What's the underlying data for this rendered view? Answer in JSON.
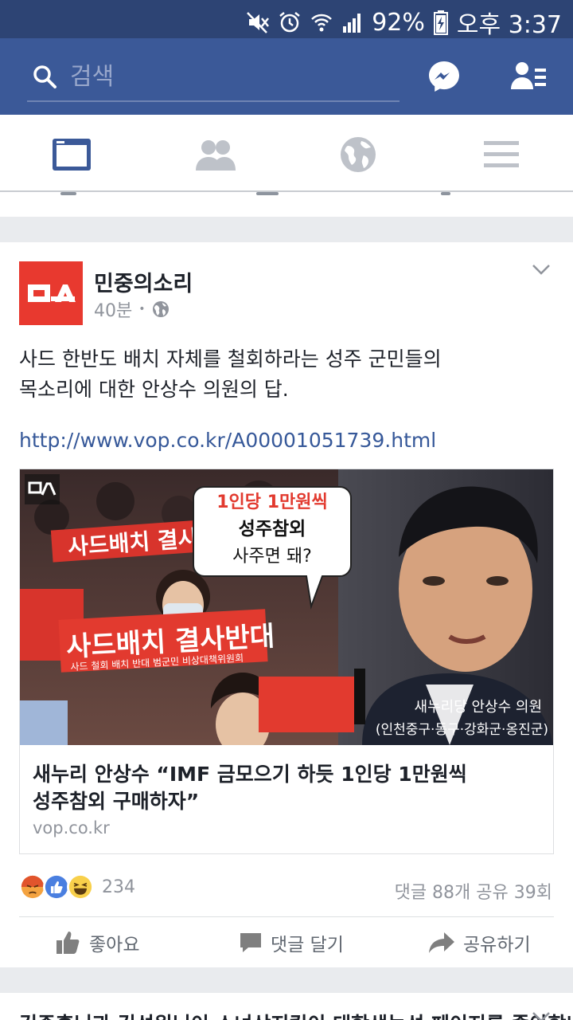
{
  "status_bar": {
    "battery": "92%",
    "time": "오후 3:37"
  },
  "search": {
    "placeholder": "검색"
  },
  "post": {
    "page_name": "민중의소리",
    "time_ago": "40분",
    "dot": "•",
    "text_line1": "사드 한반도 배치 자체를 철회하라는 성주 군민들의",
    "text_line2": "목소리에 대한 안상수 의원의 답.",
    "link": "http://www.vop.co.kr/A00001051739.html",
    "image": {
      "bubble_line1": "1인당 1만원씩",
      "bubble_line2": "성주참외",
      "bubble_line3": "사주면 돼?",
      "banner_main": "사드배치 결사반대",
      "banner_sub": "사드 철회 배치 반대 범군민 비상대책위원회",
      "banner_back": "사드배치 결사반대",
      "caption_line1": "새누리당 안상수 의원",
      "caption_line2": "(인천중구·동구·강화군·옹진군)"
    },
    "link_title_line1": "새누리 안상수 “IMF 금모으기 하듯 1인당 1만원씩",
    "link_title_line2": "성주참외 구매하자”",
    "link_domain": "vop.co.kr",
    "reaction_count": "234",
    "comments_shares": "댓글 88개 공유 39회",
    "actions": {
      "like": "좋아요",
      "comment": "댓글 달기",
      "share": "공유하기"
    }
  },
  "next_post": {
    "text": "김종훈님과 김성원님이 소녀상지킴이 대학생농성 페이지를 좋아합니다"
  },
  "colors": {
    "fb_blue": "#3b5998",
    "status_bar": "#2d4474",
    "link": "#365899",
    "avatar_red": "#e8392f"
  }
}
